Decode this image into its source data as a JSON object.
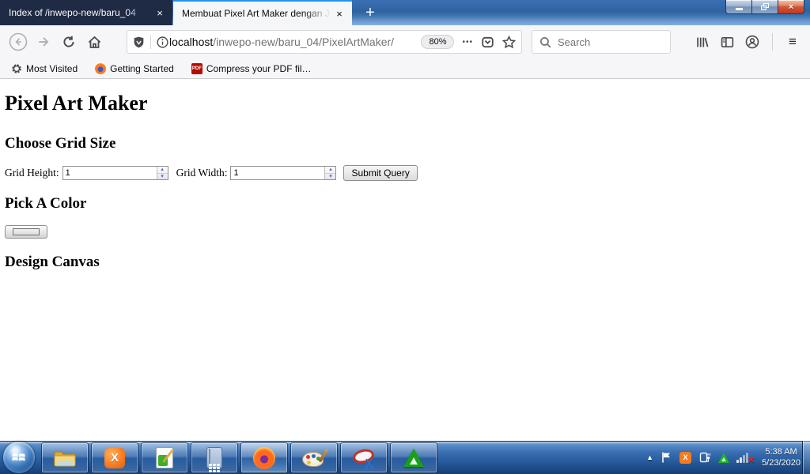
{
  "titlebar": {
    "tabs": [
      {
        "title": "Index of /inwepo-new/baru_04"
      },
      {
        "title": "Membuat Pixel Art Maker dengan J"
      }
    ]
  },
  "navbar": {
    "url": {
      "domain": "localhost",
      "path": "/inwepo-new/baru_04/PixelArtMaker/"
    },
    "zoom_level": "80%",
    "search_placeholder": "Search"
  },
  "bookmarks_bar": {
    "items": [
      {
        "label": "Most Visited",
        "icon": "gear-icon"
      },
      {
        "label": "Getting Started",
        "icon": "firefox-icon"
      },
      {
        "label": "Compress your PDF fil…",
        "icon": "pdf-icon"
      }
    ]
  },
  "page": {
    "heading": "Pixel Art Maker",
    "grid_section": {
      "heading": "Choose Grid Size",
      "height_label": "Grid Height:",
      "height_value": "1",
      "width_label": "Grid Width:",
      "width_value": "1",
      "submit_label": "Submit Query"
    },
    "color_section": {
      "heading": "Pick A Color",
      "color_value": "#000000"
    },
    "canvas_section": {
      "heading": "Design Canvas"
    }
  },
  "taskbar": {
    "apps": [
      {
        "name": "windows-explorer"
      },
      {
        "name": "xampp"
      },
      {
        "name": "notepad-plus-plus"
      },
      {
        "name": "calculator"
      },
      {
        "name": "firefox",
        "active": true
      },
      {
        "name": "paint"
      },
      {
        "name": "snipping-tool"
      },
      {
        "name": "smadav"
      }
    ],
    "tray": {
      "icons": [
        "expand-arrow",
        "action-center-flag",
        "xampp",
        "safely-remove-hardware",
        "smadav",
        "network-disconnected"
      ],
      "time": "5:38 AM",
      "date": "5/23/2020"
    }
  },
  "glyphs": {
    "close": "×",
    "plus": "+",
    "minimize": "–",
    "dots": "•••",
    "spin_up": "▴",
    "spin_down": "▾",
    "tray_expand": "▲",
    "pdf": "PDF",
    "xampp_x": "X",
    "net_x": "×",
    "burger": "≡"
  },
  "colors": {
    "active_tab_stripe": "#1d96f3",
    "inactive_tab_bg": "#1f2b45",
    "taskbar_blue": "#2a5fa2",
    "close_button_red": "#c23a20",
    "smadav_green": "#18a018",
    "xampp_orange": "#f57a20",
    "picked_color": "#000000"
  }
}
